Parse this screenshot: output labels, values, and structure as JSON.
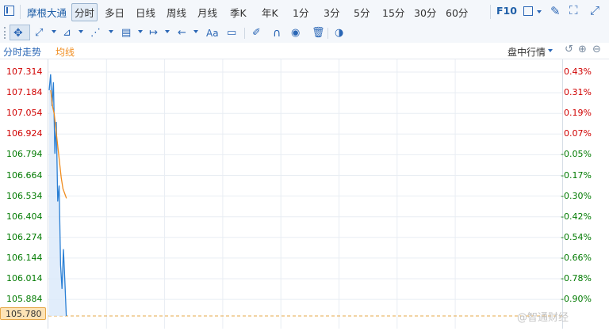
{
  "toolbar": {
    "stock_name": "摩根大通",
    "tabs": [
      "分时",
      "多日",
      "日线",
      "周线",
      "月线",
      "季K",
      "年K",
      "1分",
      "3分",
      "5分",
      "15分",
      "30分",
      "60分"
    ],
    "f10": "F10"
  },
  "drawing_tools": {
    "text_tool": "Aa"
  },
  "chart_header": {
    "title": "分时走势",
    "avg_label": "均线",
    "mode": "盘中行情"
  },
  "colors": {
    "up": "#d00000",
    "down": "#007a00",
    "price_line": "#2a7fd4",
    "avg_line": "#f08c1e",
    "accent": "#2a66b5"
  },
  "chart_data": {
    "type": "line",
    "price_ticks": [
      "107.314",
      "107.184",
      "107.054",
      "106.924",
      "106.794",
      "106.664",
      "106.534",
      "106.404",
      "106.274",
      "106.144",
      "106.014",
      "105.884"
    ],
    "pct_ticks": [
      "0.43%",
      "0.31%",
      "0.19%",
      "0.07%",
      "-0.05%",
      "-0.17%",
      "-0.30%",
      "-0.42%",
      "-0.54%",
      "-0.66%",
      "-0.78%",
      "-0.90%"
    ],
    "current_price": "105.780",
    "ylim": [
      105.78,
      107.314
    ],
    "series": [
      {
        "name": "分时走势",
        "values": [
          107.2,
          107.3,
          107.1,
          107.25,
          106.8,
          107.0,
          106.5,
          106.6,
          106.1,
          105.95,
          106.2,
          106.0,
          105.78
        ]
      },
      {
        "name": "均线",
        "values": [
          107.2,
          107.1,
          107.05,
          106.95,
          106.85,
          106.75,
          106.65,
          106.58,
          106.55,
          106.52
        ]
      }
    ]
  },
  "watermark": "@智通财经"
}
